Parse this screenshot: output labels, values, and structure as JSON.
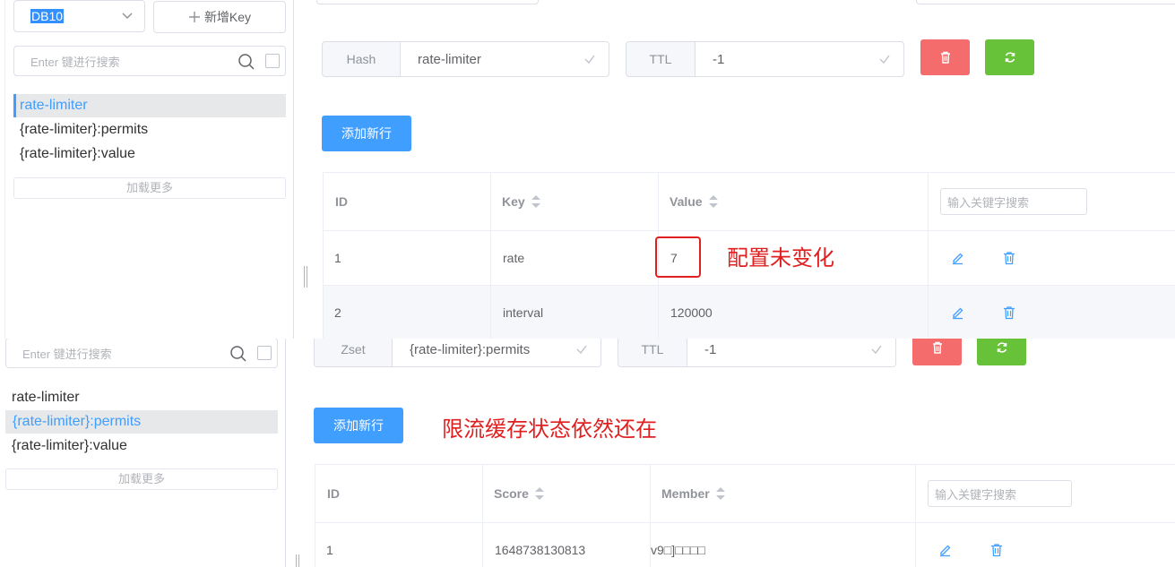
{
  "top": {
    "db_select": "DB10",
    "add_key_label": "新增Key",
    "search_placeholder": "Enter 键进行搜索",
    "keys": [
      "rate-limiter",
      "{rate-limiter}:permits",
      "{rate-limiter}:value"
    ],
    "active_key_index": 0,
    "load_more": "加载更多",
    "type_label": "Hash",
    "key_name": "rate-limiter",
    "ttl_label": "TTL",
    "ttl_value": "-1",
    "add_row_label": "添加新行",
    "table": {
      "headers": [
        "ID",
        "Key",
        "Value"
      ],
      "search_placeholder": "输入关键字搜索",
      "rows": [
        {
          "id": "1",
          "key": "rate",
          "value": "7"
        },
        {
          "id": "2",
          "key": "interval",
          "value": "120000"
        }
      ]
    },
    "annotation": "配置未变化"
  },
  "bottom": {
    "search_placeholder": "Enter 键进行搜索",
    "keys": [
      "rate-limiter",
      "{rate-limiter}:permits",
      "{rate-limiter}:value"
    ],
    "active_key_index": 1,
    "load_more": "加载更多",
    "type_label": "Zset",
    "key_name": "{rate-limiter}:permits",
    "ttl_label": "TTL",
    "ttl_value": "-1",
    "add_row_label": "添加新行",
    "table": {
      "headers": [
        "ID",
        "Score",
        "Member"
      ],
      "search_placeholder": "输入关键字搜索",
      "rows": [
        {
          "id": "1",
          "score": "1648738130813",
          "member": "v9□]□□□□"
        }
      ]
    },
    "annotation": "限流缓存状态依然还在"
  },
  "colors": {
    "primary": "#409eff",
    "danger": "#f56c6c",
    "success": "#67c23a",
    "annotation": "#e02020"
  }
}
